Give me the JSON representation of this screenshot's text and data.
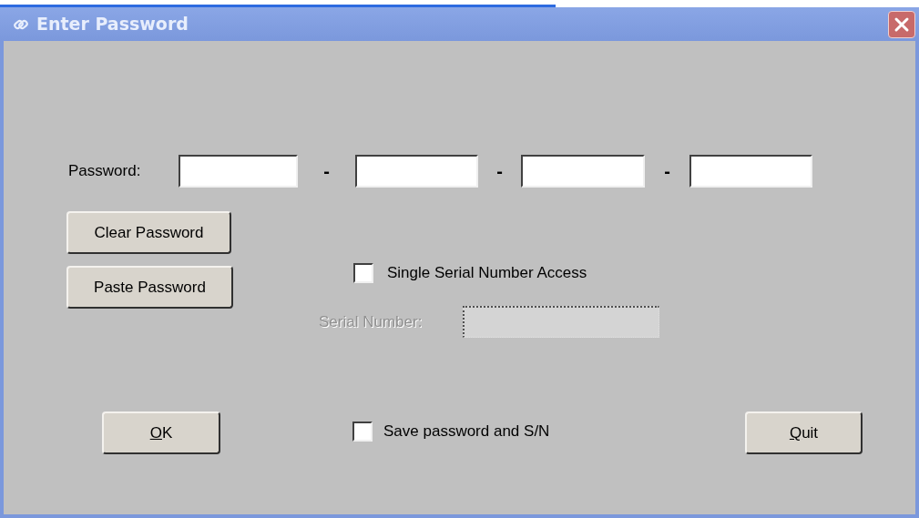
{
  "window": {
    "title": "Enter Password"
  },
  "password": {
    "label": "Password:",
    "separators": [
      "-",
      "-",
      "-"
    ]
  },
  "buttons_left": [
    {
      "label": "Clear Password"
    },
    {
      "label": "Paste Password"
    }
  ],
  "single_serial": {
    "label": "Single Serial Number Access",
    "checked": false
  },
  "serial_number": {
    "label": "Serial Number:",
    "disabled": true
  },
  "ok": {
    "label": "OK",
    "underline_first": true
  },
  "save": {
    "label": "Save password and S/N",
    "checked": false
  },
  "quit": {
    "label": "Quit",
    "underline_first": true
  }
}
